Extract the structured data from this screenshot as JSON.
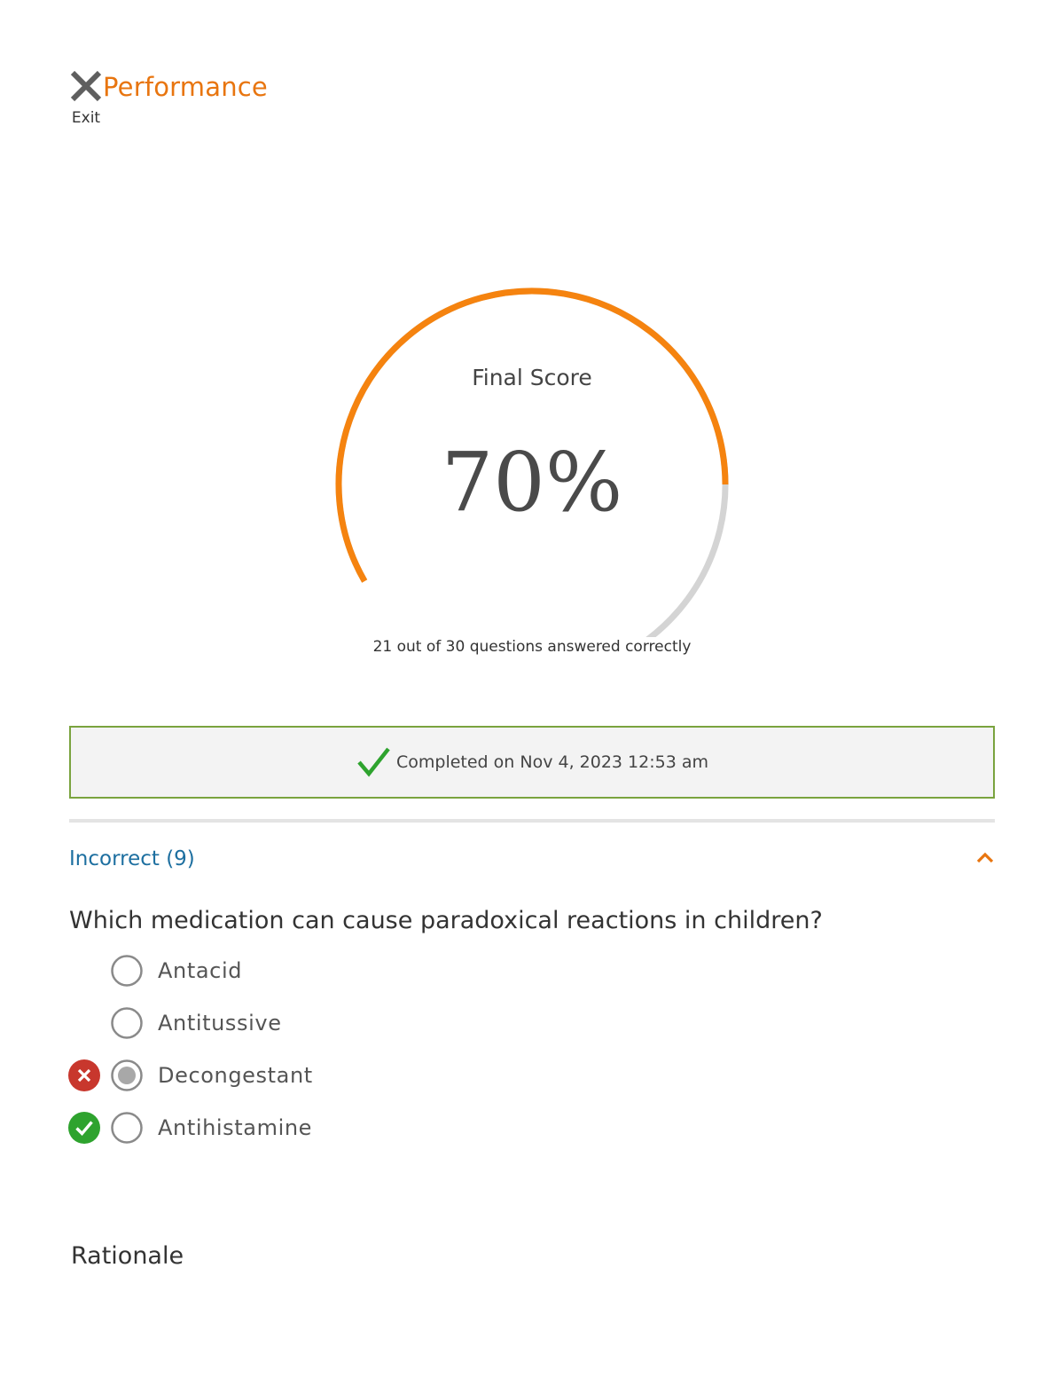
{
  "header": {
    "exit_label": "Exit",
    "title": "Performance"
  },
  "score": {
    "label": "Final Score",
    "percent_text": "70%",
    "fraction": 0.7,
    "detail": "21 out of 30 questions answered correctly"
  },
  "completion": {
    "text": "Completed on Nov 4, 2023 12:53 am"
  },
  "section": {
    "title": "Incorrect (9)"
  },
  "question": {
    "text": "Which medication can cause paradoxical reactions in children?",
    "options": [
      {
        "label": "Antacid",
        "selected": false,
        "mark": "none"
      },
      {
        "label": "Antitussive",
        "selected": false,
        "mark": "none"
      },
      {
        "label": "Decongestant",
        "selected": true,
        "mark": "incorrect"
      },
      {
        "label": "Antihistamine",
        "selected": false,
        "mark": "correct"
      }
    ]
  },
  "rationale": {
    "heading": "Rationale"
  },
  "colors": {
    "accent": "#e8750f",
    "gauge_fill": "#f5830f",
    "gauge_track": "#d4d4d4",
    "success": "#2ea32e",
    "error": "#c8372d",
    "link": "#1d6fa0",
    "banner_border": "#7aa33e"
  }
}
